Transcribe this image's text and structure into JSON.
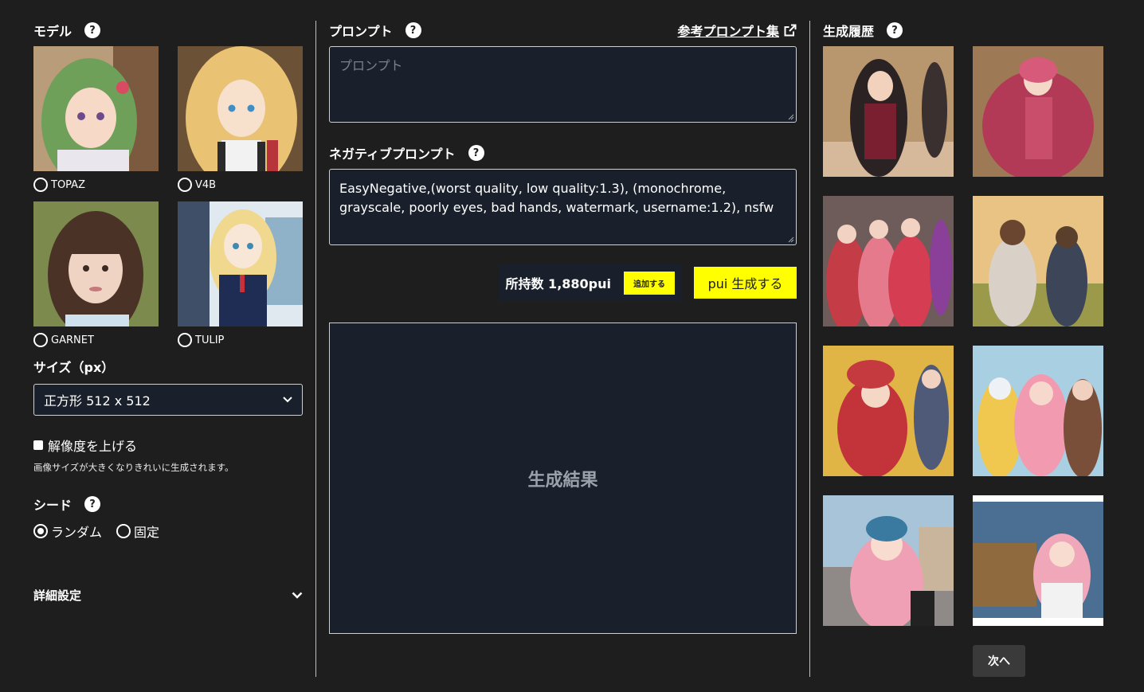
{
  "model": {
    "title": "モデル",
    "help": "?",
    "items": [
      {
        "label": "TOPAZ",
        "selected": false
      },
      {
        "label": "V4B",
        "selected": false
      },
      {
        "label": "GARNET",
        "selected": false
      },
      {
        "label": "TULIP",
        "selected": false
      }
    ]
  },
  "size": {
    "title": "サイズ（px）",
    "selected": "正方形 512 x 512"
  },
  "upscale": {
    "label": "解像度を上げる",
    "note": "画像サイズが大きくなりきれいに生成されます。"
  },
  "seed": {
    "title": "シード",
    "help": "?",
    "options": [
      {
        "label": "ランダム",
        "selected": true
      },
      {
        "label": "固定",
        "selected": false
      }
    ]
  },
  "details": {
    "label": "詳細設定"
  },
  "prompt": {
    "title": "プロンプト",
    "help": "?",
    "ref_link": "参考プロンプト集",
    "placeholder": "プロンプト"
  },
  "negative": {
    "title": "ネガティブプロンプト",
    "help": "?",
    "value": "EasyNegative,(worst quality, low quality:1.3), (monochrome, grayscale, poorly eyes, bad hands, watermark, username:1.2), nsfw"
  },
  "points": {
    "label": "所持数 1,880pui",
    "add_button": "追加する",
    "generate_button": "pui 生成する"
  },
  "result": {
    "label": "生成結果"
  },
  "history": {
    "title": "生成履歴",
    "help": "?",
    "next_button": "次へ"
  },
  "colors": {
    "background": "#1e1e1e",
    "panel": "#1a202b",
    "accent": "#ffff00"
  }
}
